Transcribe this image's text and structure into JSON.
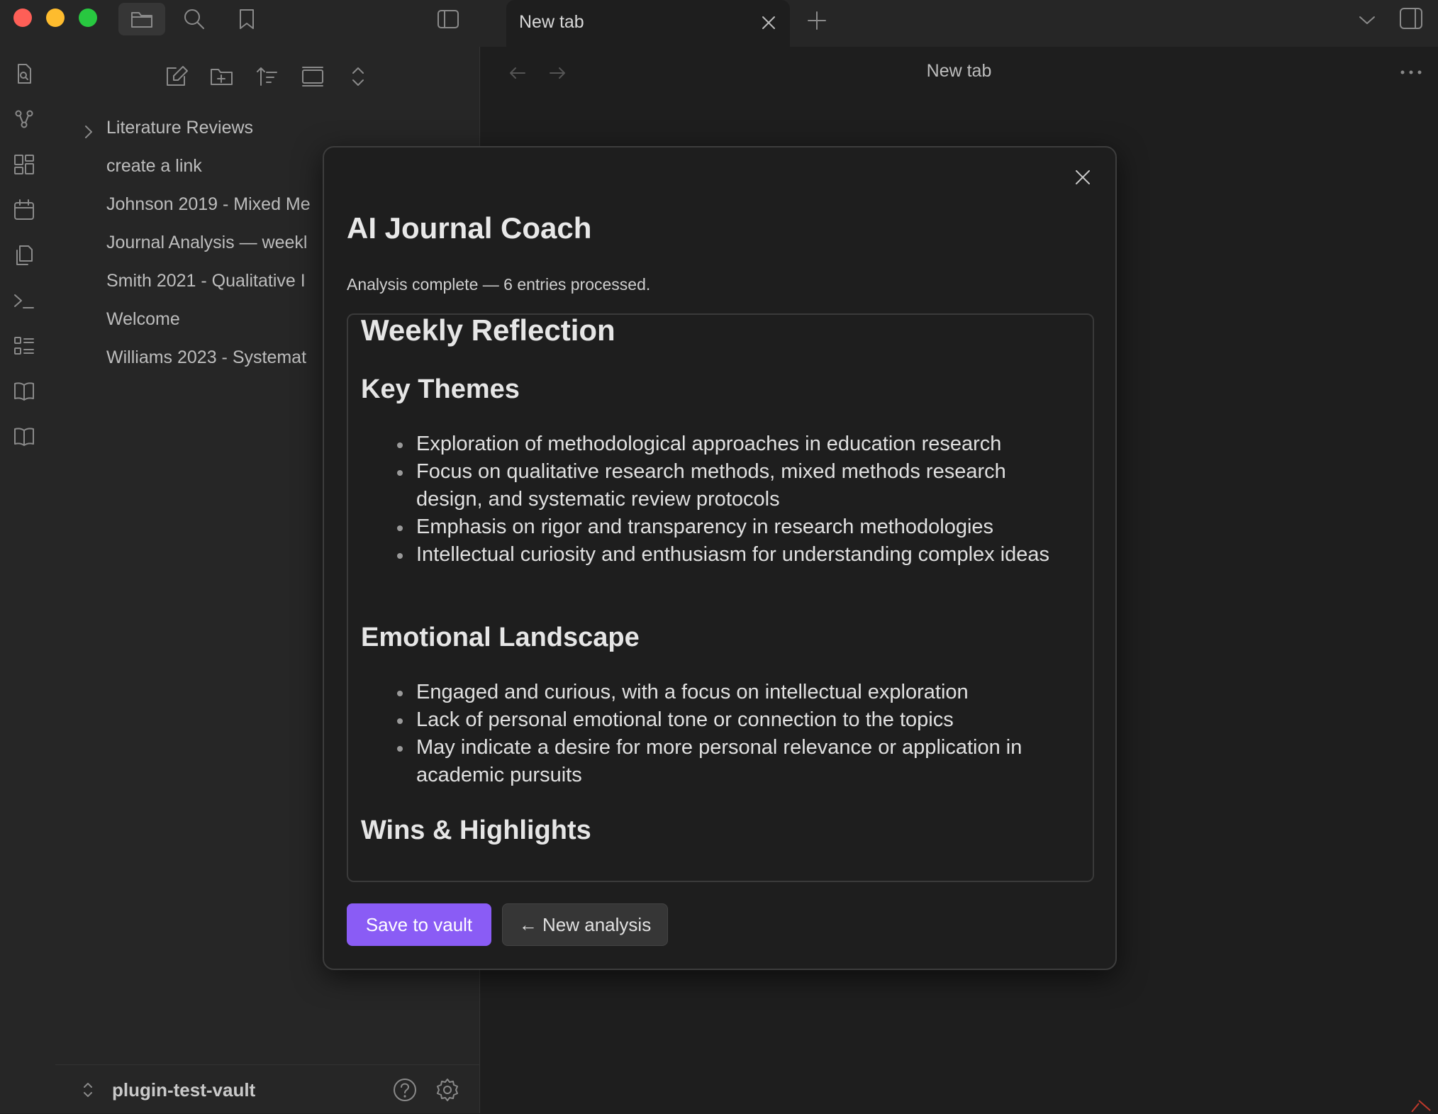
{
  "window": {
    "tab_label": "New tab"
  },
  "sidebar": {
    "files": [
      {
        "label": "Literature Reviews",
        "type": "folder"
      },
      {
        "label": "create a link"
      },
      {
        "label": "Johnson 2019 - Mixed Me"
      },
      {
        "label": "Journal Analysis — weekl"
      },
      {
        "label": "Smith 2021 - Qualitative I"
      },
      {
        "label": "Welcome"
      },
      {
        "label": "Williams 2023 - Systemat"
      }
    ],
    "vault_name": "plugin-test-vault"
  },
  "main": {
    "view_title": "New tab"
  },
  "modal": {
    "title": "AI Journal Coach",
    "status": "Analysis complete — 6 entries processed.",
    "result": {
      "heading": "Weekly Reflection",
      "sections": [
        {
          "title": "Key Themes",
          "items": [
            "Exploration of methodological approaches in education research",
            "Focus on qualitative research methods, mixed methods research design, and systematic review protocols",
            "Emphasis on rigor and transparency in research methodologies",
            "Intellectual curiosity and enthusiasm for understanding complex ideas"
          ]
        },
        {
          "title": "Emotional Landscape",
          "items": [
            "Engaged and curious, with a focus on intellectual exploration",
            "Lack of personal emotional tone or connection to the topics",
            "May indicate a desire for more personal relevance or application in academic pursuits"
          ]
        },
        {
          "title": "Wins & Highlights",
          "items": []
        }
      ]
    },
    "save_button": "Save to vault",
    "new_analysis_button": "← New analysis"
  },
  "colors": {
    "accent": "#8a5cf5",
    "traffic_red": "#fe5f57",
    "traffic_yellow": "#febc2e",
    "traffic_green": "#28c840"
  }
}
